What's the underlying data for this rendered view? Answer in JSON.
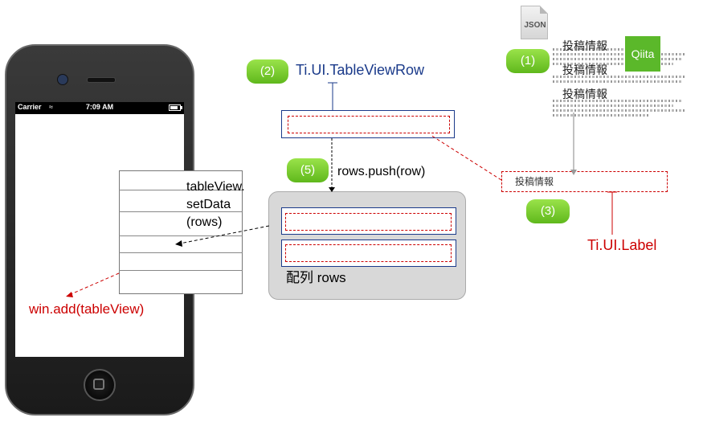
{
  "phone": {
    "status": {
      "carrier": "Carrier",
      "time": "7:09 AM"
    }
  },
  "tableview_label": [
    "tableView.",
    "setData",
    "(rows)"
  ],
  "win_add": "win.add(tableView)",
  "badges": {
    "step2": "(2)",
    "step5": "(5)",
    "step1": "(1)",
    "step3": "(3)"
  },
  "table_view_row_label": "Ti.UI.TableViewRow",
  "push_label": "rows.push(row)",
  "array_label": "配列 rows",
  "json_icon": {
    "text": "JSON",
    "icon": "json-file-icon"
  },
  "qiita_logo": {
    "text": "Qiita"
  },
  "post_info_items": [
    "投稿情報",
    "投稿情報",
    "投稿情報"
  ],
  "label_box_text": "投稿情報",
  "ui_label": "Ti.UI.Label",
  "colors": {
    "red": "#cc0000",
    "blue": "#1a3a8a",
    "green": "#6cc72a",
    "gray": "#d8d8d8"
  }
}
